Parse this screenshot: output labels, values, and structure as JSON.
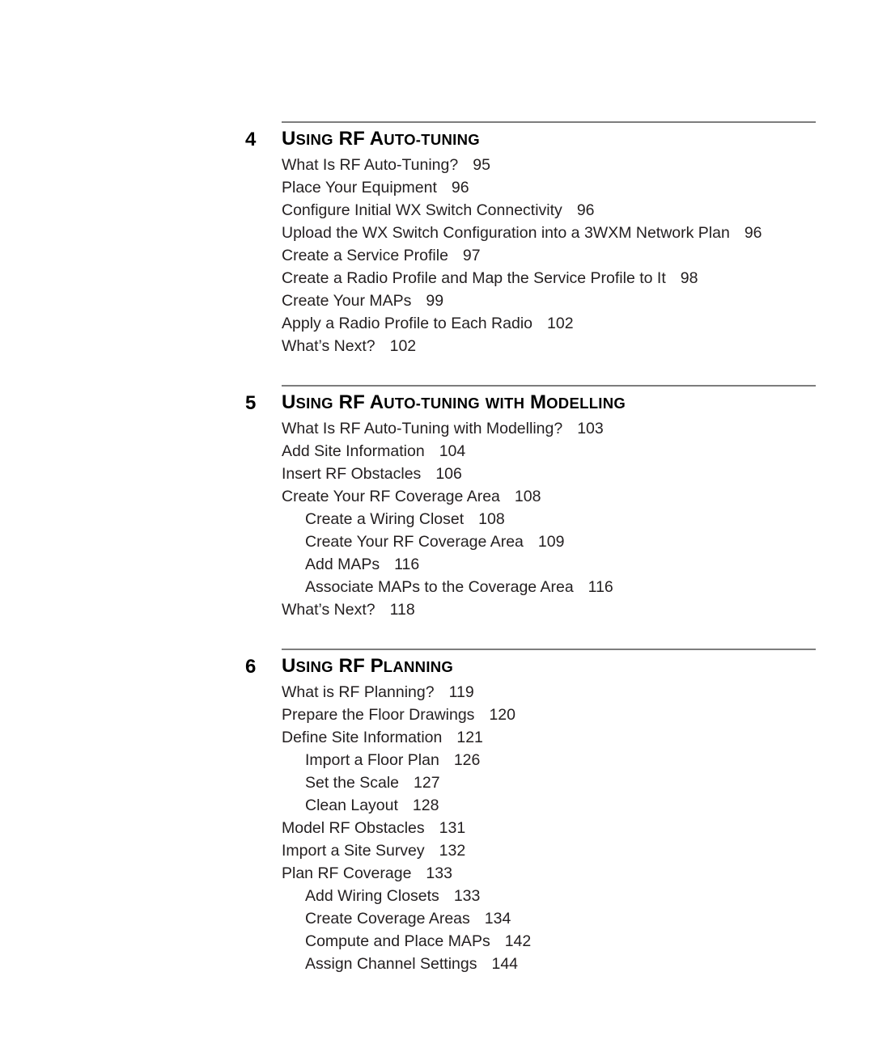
{
  "document": {
    "type": "table-of-contents"
  },
  "chapters": [
    {
      "number": "4",
      "title": "Using RF Auto-Tuning",
      "title_words": [
        {
          "cap": "U",
          "rest": "SING"
        },
        {
          "cap": "RF",
          "rest": ""
        },
        {
          "cap": "A",
          "rest": "UTO-"
        },
        {
          "cap": "T",
          "rest": "UNING"
        }
      ],
      "entries": [
        {
          "label": "What Is RF Auto-Tuning?",
          "page": "95",
          "level": 1
        },
        {
          "label": "Place Your Equipment",
          "page": "96",
          "level": 1
        },
        {
          "label": "Configure Initial WX Switch Connectivity",
          "page": "96",
          "level": 1
        },
        {
          "label": "Upload the WX Switch Configuration into a 3WXM Network Plan",
          "page": "96",
          "level": 1
        },
        {
          "label": "Create a Service Profile",
          "page": "97",
          "level": 1
        },
        {
          "label": "Create a Radio Profile and Map the Service Profile to It",
          "page": "98",
          "level": 1
        },
        {
          "label": "Create Your MAPs",
          "page": "99",
          "level": 1
        },
        {
          "label": "Apply a Radio Profile to Each Radio",
          "page": "102",
          "level": 1
        },
        {
          "label": "What’s Next?",
          "page": "102",
          "level": 1
        }
      ]
    },
    {
      "number": "5",
      "title": "Using RF Auto-Tuning with Modelling",
      "entries": [
        {
          "label": "What Is RF Auto-Tuning with Modelling?",
          "page": "103",
          "level": 1
        },
        {
          "label": "Add Site Information",
          "page": "104",
          "level": 1
        },
        {
          "label": "Insert RF Obstacles",
          "page": "106",
          "level": 1
        },
        {
          "label": "Create Your RF Coverage Area",
          "page": "108",
          "level": 1
        },
        {
          "label": "Create a Wiring Closet",
          "page": "108",
          "level": 2
        },
        {
          "label": "Create Your RF Coverage Area",
          "page": "109",
          "level": 2
        },
        {
          "label": "Add MAPs",
          "page": "116",
          "level": 2
        },
        {
          "label": "Associate MAPs to the Coverage Area",
          "page": "116",
          "level": 2
        },
        {
          "label": "What’s Next?",
          "page": "118",
          "level": 1
        }
      ]
    },
    {
      "number": "6",
      "title": "Using RF Planning",
      "entries": [
        {
          "label": "What is RF Planning?",
          "page": "119",
          "level": 1
        },
        {
          "label": "Prepare the Floor Drawings",
          "page": "120",
          "level": 1
        },
        {
          "label": "Define Site Information",
          "page": "121",
          "level": 1
        },
        {
          "label": "Import a Floor Plan",
          "page": "126",
          "level": 2
        },
        {
          "label": "Set the Scale",
          "page": "127",
          "level": 2
        },
        {
          "label": "Clean Layout",
          "page": "128",
          "level": 2
        },
        {
          "label": "Model RF Obstacles",
          "page": "131",
          "level": 1
        },
        {
          "label": "Import a Site Survey",
          "page": "132",
          "level": 1
        },
        {
          "label": "Plan RF Coverage",
          "page": "133",
          "level": 1
        },
        {
          "label": "Add Wiring Closets",
          "page": "133",
          "level": 2
        },
        {
          "label": "Create Coverage Areas",
          "page": "134",
          "level": 2
        },
        {
          "label": "Compute and Place MAPs",
          "page": "142",
          "level": 2
        },
        {
          "label": "Assign Channel Settings",
          "page": "144",
          "level": 2
        }
      ]
    }
  ]
}
